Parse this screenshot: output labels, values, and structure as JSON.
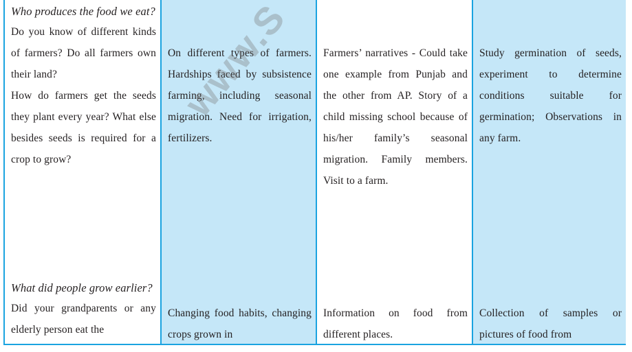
{
  "watermark": "www.S",
  "colors": {
    "border": "#1aa3e0",
    "shaded_column": "#c5e7f8",
    "text": "#231f20"
  },
  "table": {
    "col1": {
      "top_heading": "Who produces the food we eat?",
      "top_paragraphs": [
        "Do you know of different kinds of farmers? Do all farmers own their land?",
        "How do farmers get the seeds they plant every year? What else besides seeds is required for a crop to grow?"
      ],
      "bottom_heading": "What did people grow earlier?",
      "bottom_paragraph": "Did your grandparents or any elderly person eat the"
    },
    "col2": {
      "top_paragraph": "On different types of farmers. Hardships faced by subsistence farming, including seasonal migration. Need for irrigation, fertilizers.",
      "bottom_paragraph": "Changing food habits, changing crops grown in"
    },
    "col3": {
      "top_paragraph": "Farmers’ narratives - Could take one example from Punjab and the other from AP. Story of a child missing school because of his/her family’s seasonal migration. Family members. Visit to a farm.",
      "bottom_paragraph": "Information on food from different places."
    },
    "col4": {
      "top_paragraph": "Study germination of seeds, experiment to determine conditions suitable for germination; Observations in any farm.",
      "bottom_paragraph": "Collection of samples or pictures of food from"
    }
  }
}
